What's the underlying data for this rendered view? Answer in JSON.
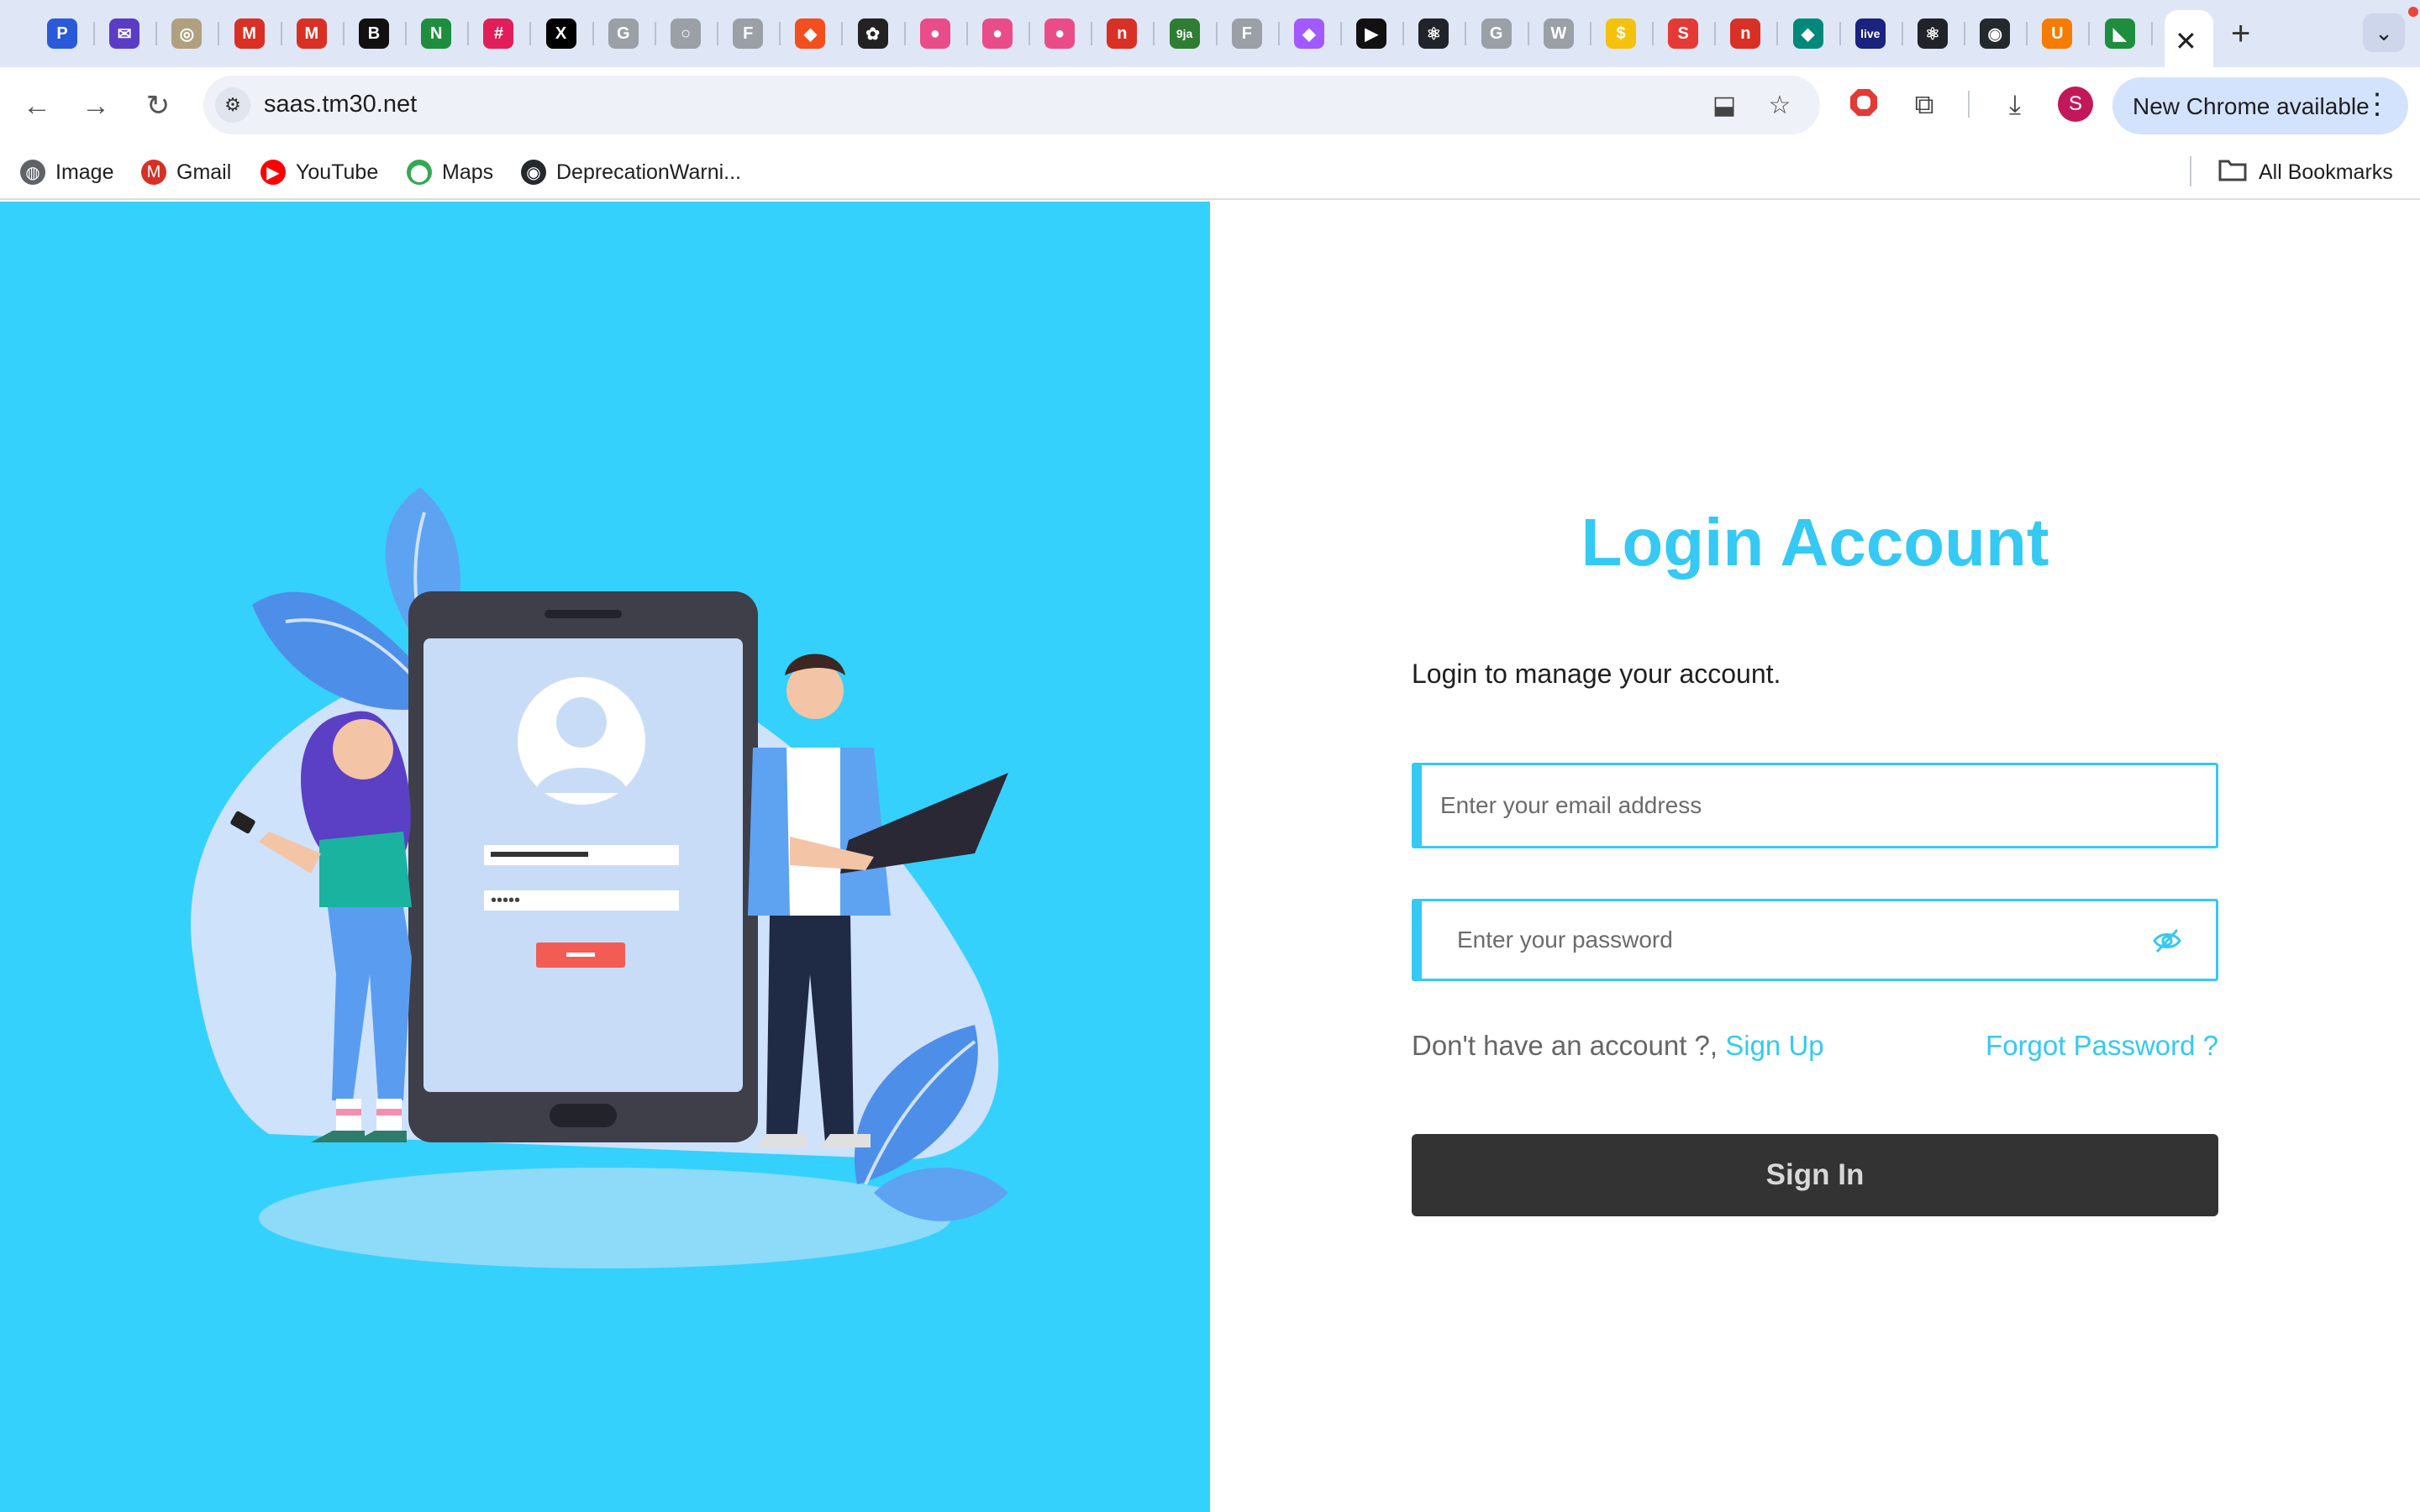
{
  "browser": {
    "tabs": [
      {
        "icon": "p-icon",
        "glyph": "P",
        "color": "#2a5ad7"
      },
      {
        "icon": "mail-icon",
        "glyph": "✉",
        "color": "#5b3cc4"
      },
      {
        "icon": "compass-icon",
        "glyph": "◎",
        "color": "#b0a080"
      },
      {
        "icon": "gmail-icon",
        "glyph": "M",
        "color": "#d93025"
      },
      {
        "icon": "gmail-icon",
        "glyph": "M",
        "color": "#d93025"
      },
      {
        "icon": "b-icon",
        "glyph": "B",
        "color": "#111111"
      },
      {
        "icon": "n-icon",
        "glyph": "N",
        "color": "#1e8e3e"
      },
      {
        "icon": "slack-icon",
        "glyph": "#",
        "color": "#e01e5a"
      },
      {
        "icon": "x-icon",
        "glyph": "X",
        "color": "#000000"
      },
      {
        "icon": "google-icon",
        "glyph": "G",
        "color": "#9aa0a6"
      },
      {
        "icon": "globe-icon",
        "glyph": "○",
        "color": "#9aa0a6"
      },
      {
        "icon": "f-icon",
        "glyph": "F",
        "color": "#9aa0a6"
      },
      {
        "icon": "figma-icon",
        "glyph": "◆",
        "color": "#f24e1e"
      },
      {
        "icon": "openai-icon",
        "glyph": "✿",
        "color": "#222222"
      },
      {
        "icon": "dribbble-icon",
        "glyph": "●",
        "color": "#ea4c89"
      },
      {
        "icon": "dribbble-icon",
        "glyph": "●",
        "color": "#ea4c89"
      },
      {
        "icon": "dribbble-icon",
        "glyph": "●",
        "color": "#ea4c89"
      },
      {
        "icon": "n-circle-icon",
        "glyph": "n",
        "color": "#d93025"
      },
      {
        "icon": "naija-icon",
        "glyph": "9ja",
        "color": "#2e7d32"
      },
      {
        "icon": "f-icon",
        "glyph": "F",
        "color": "#9aa0a6"
      },
      {
        "icon": "figma-icon",
        "glyph": "◆",
        "color": "#a259ff"
      },
      {
        "icon": "play-icon",
        "glyph": "▶",
        "color": "#111111"
      },
      {
        "icon": "react-icon",
        "glyph": "⚛",
        "color": "#20232a"
      },
      {
        "icon": "google-icon",
        "glyph": "G",
        "color": "#9aa0a6"
      },
      {
        "icon": "wikipedia-icon",
        "glyph": "W",
        "color": "#9aa0a6"
      },
      {
        "icon": "bank-icon",
        "glyph": "$",
        "color": "#f4c20d"
      },
      {
        "icon": "s-icon",
        "glyph": "S",
        "color": "#e53935"
      },
      {
        "icon": "n-circle-icon",
        "glyph": "n",
        "color": "#d93025"
      },
      {
        "icon": "diamond-icon",
        "glyph": "◆",
        "color": "#00897b"
      },
      {
        "icon": "live-icon",
        "glyph": "live",
        "color": "#1a237e"
      },
      {
        "icon": "react-icon",
        "glyph": "⚛",
        "color": "#20232a"
      },
      {
        "icon": "github-icon",
        "glyph": "◉",
        "color": "#24292e"
      },
      {
        "icon": "u-icon",
        "glyph": "U",
        "color": "#f57c00"
      },
      {
        "icon": "flag-icon",
        "glyph": "◣",
        "color": "#1e8e3e"
      }
    ],
    "active_tab_close": "✕",
    "new_tab": "+",
    "tab_search": "⌄",
    "url": "saas.tm30.net",
    "update_label": "New Chrome available",
    "profile_initial": "S",
    "bookmarks": [
      {
        "label": "Image",
        "icon": "globe-icon",
        "glyph": "◍",
        "color": "#5f6368"
      },
      {
        "label": "Gmail",
        "icon": "gmail-icon",
        "glyph": "M",
        "color": "#d93025"
      },
      {
        "label": "YouTube",
        "icon": "youtube-icon",
        "glyph": "▶",
        "color": "#ff0000"
      },
      {
        "label": "Maps",
        "icon": "maps-pin-icon",
        "glyph": "⬤",
        "color": "#34a853"
      },
      {
        "label": "DeprecationWarni...",
        "icon": "github-icon",
        "glyph": "◉",
        "color": "#24292e"
      }
    ],
    "all_bookmarks": "All Bookmarks"
  },
  "page": {
    "colors": {
      "accent": "#35c9f3",
      "panel": "#35d1fd",
      "button": "#333333"
    },
    "title": "Login Account",
    "subtitle": "Login to manage your account.",
    "email_placeholder": "Enter your email address",
    "password_placeholder": "Enter your password",
    "no_account_text": "Don't have an account ?,",
    "signup_link": "Sign Up",
    "forgot_link": "Forgot Password ?",
    "signin_label": "Sign In"
  }
}
